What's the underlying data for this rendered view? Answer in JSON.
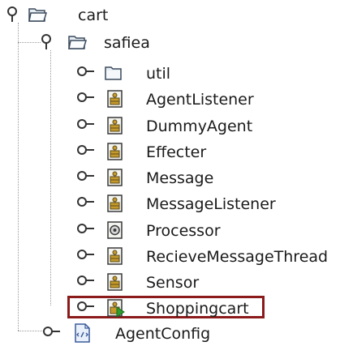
{
  "tree": {
    "root": {
      "label": "cart",
      "icon": "open-folder-icon",
      "expanded": true
    },
    "package": {
      "label": "safiea",
      "icon": "open-folder-icon",
      "expanded": true
    },
    "children": [
      {
        "label": "util",
        "icon": "folder-icon",
        "expanded": false
      },
      {
        "label": "AgentListener",
        "icon": "java-class-icon",
        "expanded": false
      },
      {
        "label": "DummyAgent",
        "icon": "java-class-icon",
        "expanded": false
      },
      {
        "label": "Effecter",
        "icon": "java-class-icon",
        "expanded": false
      },
      {
        "label": "Message",
        "icon": "java-class-icon",
        "expanded": false
      },
      {
        "label": "MessageListener",
        "icon": "java-class-icon",
        "expanded": false
      },
      {
        "label": "Processor",
        "icon": "java-interface-icon",
        "expanded": false
      },
      {
        "label": "RecieveMessageThread",
        "icon": "java-class-icon",
        "expanded": false
      },
      {
        "label": "Sensor",
        "icon": "java-class-icon",
        "expanded": false
      },
      {
        "label": "Shoppingcart",
        "icon": "java-main-class-icon",
        "expanded": false,
        "highlighted": true
      }
    ],
    "sibling": {
      "label": "AgentConfig",
      "icon": "xml-file-icon",
      "expanded": false
    }
  },
  "colors": {
    "highlight_border": "#8b1a1a",
    "folder_fill": "#e7edf3",
    "folder_stroke": "#3a4a5c",
    "run_arrow": "#2e9d2e"
  }
}
